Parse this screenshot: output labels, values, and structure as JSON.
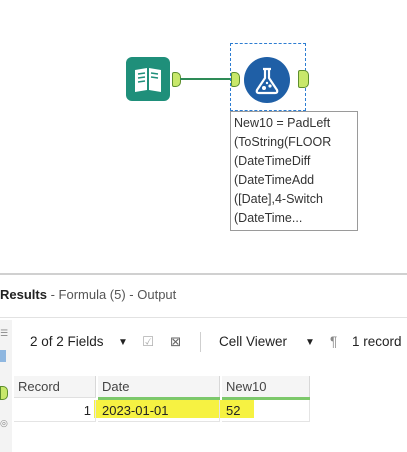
{
  "canvas": {
    "annotation_lines": [
      "New10 = PadLeft",
      "(ToString(FLOOR",
      "(DateTimeDiff",
      "(DateTimeAdd",
      "([Date],4-Switch",
      "(DateTime..."
    ]
  },
  "results": {
    "title_bold": "Results",
    "title_rest": " - Formula (5) - Output",
    "fields_label": "2 of 2 Fields",
    "cell_viewer_label": "Cell Viewer",
    "records_label": "1 record",
    "columns": [
      "Record",
      "Date",
      "New10"
    ],
    "row": {
      "record": "1",
      "date": "2023-01-01",
      "new10": "52"
    }
  },
  "colors": {
    "input_tool": "#1f8f7a",
    "formula_tool": "#1f5fa6",
    "anchor": "#c8e86b",
    "highlight": "#f4f021"
  },
  "icons": [
    "book-input-icon",
    "flask-formula-icon",
    "dropdown-arrow-icon",
    "checkbox-icon",
    "clear-icon",
    "pilcrow-icon"
  ]
}
